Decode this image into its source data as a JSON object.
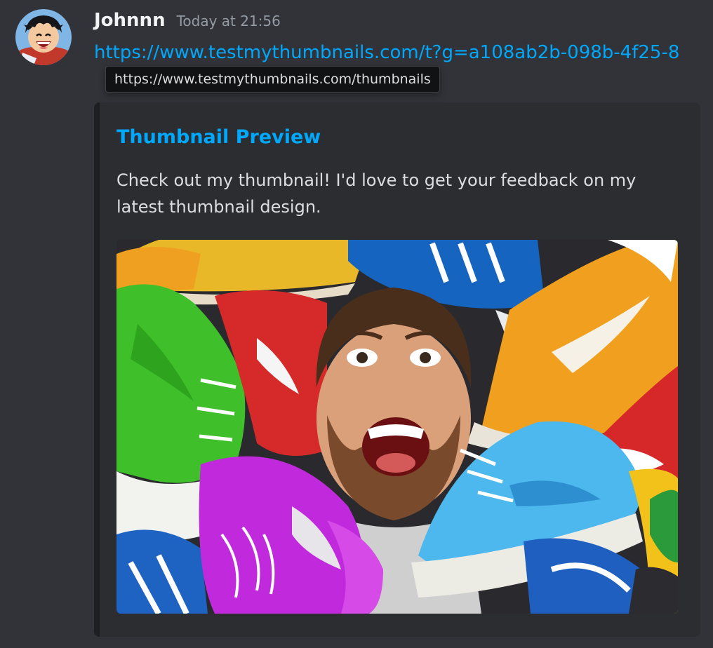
{
  "message": {
    "author": "Johnnn",
    "timestamp": "Today at 21:56",
    "link_text": "https://www.testmythumbnails.com/t?g=a108ab2b-098b-4f25-8",
    "link_tooltip": "https://www.testmythumbnails.com/thumbnails",
    "avatar_icon": "anime-character-avatar-icon"
  },
  "embed": {
    "title": "Thumbnail Preview",
    "description": "Check out my thumbnail! I'd love to get your feedback on my latest thumbnail design.",
    "image_icon": "thumbnail-image-person-with-sneakers"
  },
  "colors": {
    "background": "#313338",
    "embed_background": "#2b2d31",
    "link": "#00a8fc",
    "username": "#f2f3f5",
    "timestamp": "#949ba4"
  }
}
